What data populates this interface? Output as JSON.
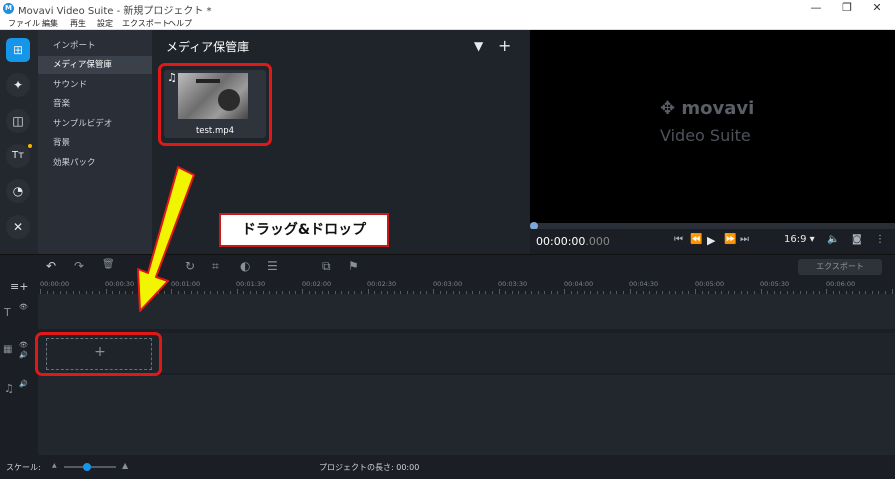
{
  "window": {
    "title": "Movavi Video Suite - 新規プロジェクト *",
    "logo_letter": "M",
    "minimize": "—",
    "maximize": "❐",
    "close": "✕"
  },
  "menu": [
    "ファイル",
    "編集",
    "再生",
    "設定",
    "エクスポート",
    "ヘルプ"
  ],
  "rail": {
    "items": [
      {
        "name": "import-icon",
        "glyph": "⊞",
        "active": true
      },
      {
        "name": "effects-icon",
        "glyph": "✦",
        "active": false
      },
      {
        "name": "transitions-icon",
        "glyph": "◫",
        "active": false
      },
      {
        "name": "titles-icon",
        "glyph": "Tт",
        "active": false
      },
      {
        "name": "stickers-icon",
        "glyph": "◔",
        "active": false
      },
      {
        "name": "tools-icon",
        "glyph": "✕",
        "active": false
      }
    ]
  },
  "categories": [
    {
      "label": "インポート",
      "selected": false
    },
    {
      "label": "メディア保管庫",
      "selected": true
    },
    {
      "label": "サウンド",
      "selected": false
    },
    {
      "label": "音楽",
      "selected": false
    },
    {
      "label": "サンプルビデオ",
      "selected": false
    },
    {
      "label": "背景",
      "selected": false
    },
    {
      "label": "効果パック",
      "selected": false
    }
  ],
  "media": {
    "heading": "メディア保管庫",
    "filter_glyph": "▼",
    "add_glyph": "+",
    "file": {
      "name": "test.mp4",
      "music_glyph": "♫"
    }
  },
  "preview": {
    "brand": "✥ movavi",
    "brand_sub": "Video Suite",
    "timecode": "00:00:00",
    "timecode_ms": ".000",
    "aspect": "16:9 ▾",
    "controls": [
      "⏮",
      "⏪",
      "▶",
      "⏩",
      "⏭"
    ],
    "volume_glyph": "🔈",
    "camera_glyph": "◙",
    "more_glyph": "⋮"
  },
  "toolbar": {
    "undo": "↶",
    "redo": "↷",
    "delete": "🗑",
    "rotate": "↻",
    "crop": "⌗",
    "color": "◐",
    "props": "☰",
    "stabilize": "⧉",
    "flag": "⚑",
    "export_label": "エクスポート"
  },
  "ruler": [
    "00:00:00",
    "00:00:30",
    "00:01:00",
    "00:01:30",
    "00:02:00",
    "00:02:30",
    "00:03:00",
    "00:03:30",
    "00:04:00",
    "00:04:30",
    "00:05:00",
    "00:05:30",
    "00:06:00"
  ],
  "tracks": {
    "add_track": "≡+",
    "title_icon": "T",
    "video_icon": "▦",
    "audio_icon": "♫",
    "eye": "👁",
    "speaker": "🔊",
    "drop_plus": "+"
  },
  "status": {
    "scale_label": "スケール:",
    "zoom_out": "▲",
    "zoom_in": "▲",
    "project_length": "プロジェクトの長さ: 00:00",
    "zoom_level": 0.45
  },
  "annotation": {
    "callout": "ドラッグ&ドロップ",
    "arrow_color": "#f2f500",
    "box_color": "#e01818"
  }
}
